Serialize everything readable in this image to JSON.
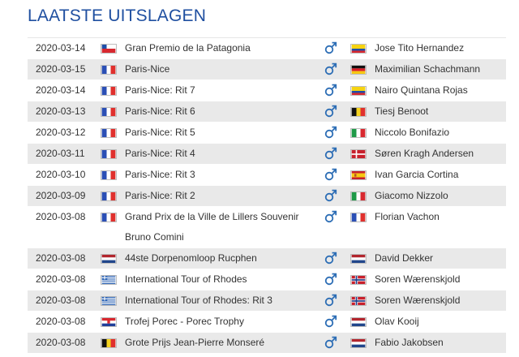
{
  "title": "LAATSTE UITSLAGEN",
  "colors": {
    "title": "#1f4fa0",
    "gender_icon": "#2c6db5",
    "row_alt": "#e9e9e9"
  },
  "gender_icon": "male-icon",
  "results": [
    {
      "date": "2020-03-14",
      "race": "Gran Premio de la Patagonia",
      "race_flag": "CL",
      "rider": "Jose Tito Hernandez",
      "rider_flag": "CO"
    },
    {
      "date": "2020-03-15",
      "race": "Paris-Nice",
      "race_flag": "FR",
      "rider": "Maximilian Schachmann",
      "rider_flag": "DE"
    },
    {
      "date": "2020-03-14",
      "race": "Paris-Nice: Rit 7",
      "race_flag": "FR",
      "rider": "Nairo Quintana Rojas",
      "rider_flag": "CO"
    },
    {
      "date": "2020-03-13",
      "race": "Paris-Nice: Rit 6",
      "race_flag": "FR",
      "rider": "Tiesj Benoot",
      "rider_flag": "BE"
    },
    {
      "date": "2020-03-12",
      "race": "Paris-Nice: Rit 5",
      "race_flag": "FR",
      "rider": "Niccolo Bonifazio",
      "rider_flag": "IT"
    },
    {
      "date": "2020-03-11",
      "race": "Paris-Nice: Rit 4",
      "race_flag": "FR",
      "rider": "Søren Kragh Andersen",
      "rider_flag": "DK"
    },
    {
      "date": "2020-03-10",
      "race": "Paris-Nice: Rit 3",
      "race_flag": "FR",
      "rider": "Ivan Garcia Cortina",
      "rider_flag": "ES"
    },
    {
      "date": "2020-03-09",
      "race": "Paris-Nice: Rit 2",
      "race_flag": "FR",
      "rider": "Giacomo Nizzolo",
      "rider_flag": "IT"
    },
    {
      "date": "2020-03-08",
      "race": "Grand Prix de la Ville de Lillers Souvenir Bruno Comini",
      "race_flag": "FR",
      "rider": "Florian Vachon",
      "rider_flag": "FR"
    },
    {
      "date": "2020-03-08",
      "race": "44ste Dorpenomloop Rucphen",
      "race_flag": "NL",
      "rider": "David Dekker",
      "rider_flag": "NL"
    },
    {
      "date": "2020-03-08",
      "race": "International Tour of Rhodes",
      "race_flag": "GR",
      "rider": "Soren Wærenskjold",
      "rider_flag": "NO"
    },
    {
      "date": "2020-03-08",
      "race": "International Tour of Rhodes: Rit 3",
      "race_flag": "GR",
      "rider": "Soren Wærenskjold",
      "rider_flag": "NO"
    },
    {
      "date": "2020-03-08",
      "race": "Trofej Porec - Porec Trophy",
      "race_flag": "HR",
      "rider": "Olav Kooij",
      "rider_flag": "NL"
    },
    {
      "date": "2020-03-08",
      "race": "Grote Prijs Jean-Pierre Monseré",
      "race_flag": "BE",
      "rider": "Fabio Jakobsen",
      "rider_flag": "NL"
    }
  ]
}
